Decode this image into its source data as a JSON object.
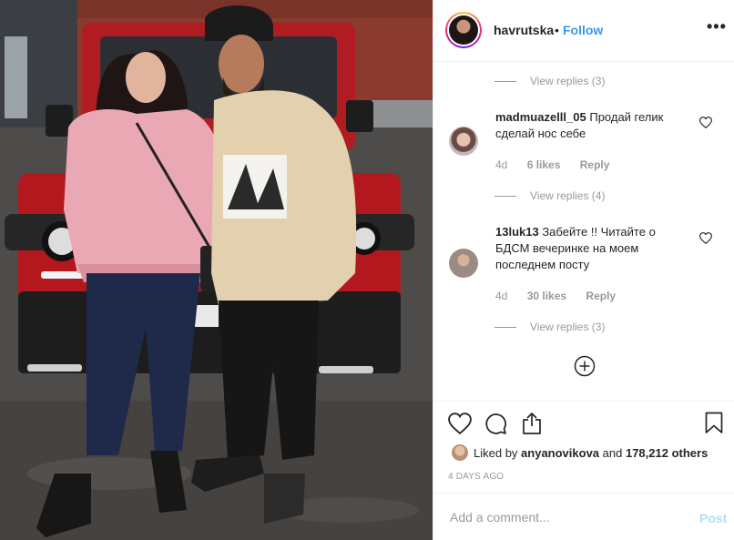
{
  "post": {
    "username": "havrutska",
    "separator": "•",
    "follow_label": "Follow",
    "more_label": "•••"
  },
  "comments": {
    "view_replies_1": "View replies (3)",
    "items": [
      {
        "username": "madmuazelll_05",
        "text": "Продай гелик сделай нос себе",
        "age": "4d",
        "likes": "6 likes",
        "reply_label": "Reply",
        "view_replies": "View replies (4)"
      },
      {
        "username": "13luk13",
        "text": "Забейте !! Читайте о БДСМ вечеринке на моем последнем посту",
        "age": "4d",
        "likes": "30 likes",
        "reply_label": "Reply",
        "view_replies": "View replies (3)"
      }
    ]
  },
  "likes": {
    "prefix": "Liked by ",
    "user": "anyanovikova",
    "middle": " and ",
    "count": "178,212 others"
  },
  "date": "4 DAYS AGO",
  "add_comment": {
    "placeholder": "Add a comment...",
    "post_label": "Post",
    "post_color": "#b2dffc"
  },
  "colors": {
    "link": "#3897f0",
    "muted": "#999999",
    "text": "#262626"
  },
  "icons": [
    "heart-icon",
    "comment-icon",
    "share-icon",
    "bookmark-icon",
    "plus-circle-icon",
    "more-icon"
  ]
}
